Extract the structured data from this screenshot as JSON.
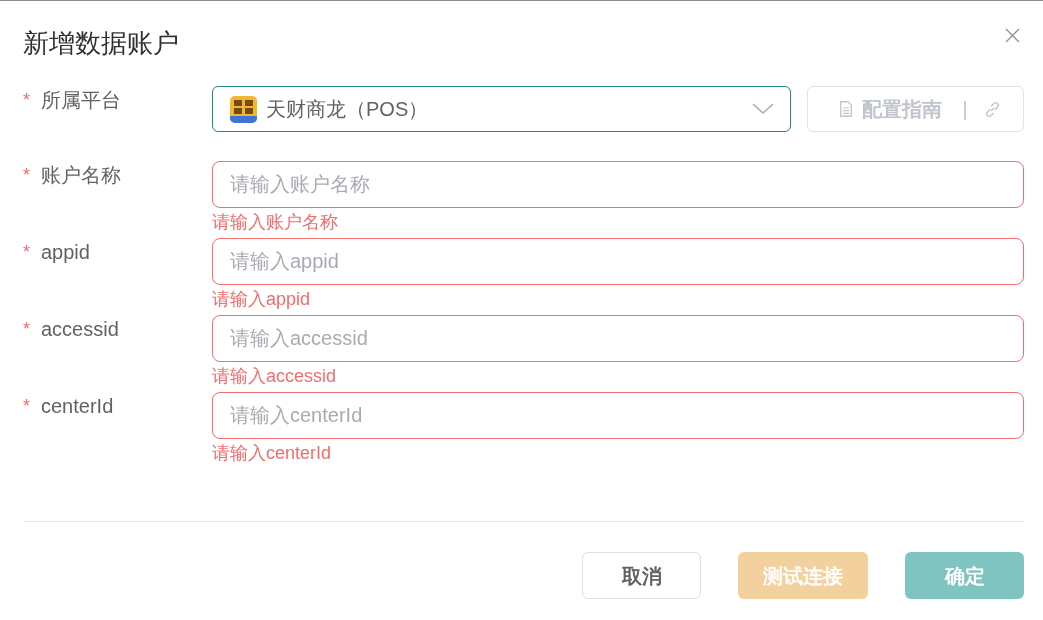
{
  "dialog": {
    "title": "新增数据账户"
  },
  "form": {
    "platform": {
      "required_mark": "*",
      "label": "所属平台",
      "value": "天财商龙（POS）",
      "focused": true,
      "guide_button": {
        "label": "配置指南",
        "separator": "|",
        "disabled": true
      }
    },
    "fields": [
      {
        "required_mark": "*",
        "label": "账户名称",
        "placeholder": "请输入账户名称",
        "error": "请输入账户名称"
      },
      {
        "required_mark": "*",
        "label": "appid",
        "placeholder": "请输入appid",
        "error": "请输入appid"
      },
      {
        "required_mark": "*",
        "label": "accessid",
        "placeholder": "请输入accessid",
        "error": "请输入accessid"
      },
      {
        "required_mark": "*",
        "label": "centerId",
        "placeholder": "请输入centerId",
        "error": "请输入centerId"
      }
    ]
  },
  "footer_buttons": [
    {
      "label": "取消",
      "kind": "default",
      "disabled": false
    },
    {
      "label": "测试连接",
      "kind": "warning",
      "disabled": true
    },
    {
      "label": "确定",
      "kind": "primary",
      "disabled": true
    }
  ]
}
